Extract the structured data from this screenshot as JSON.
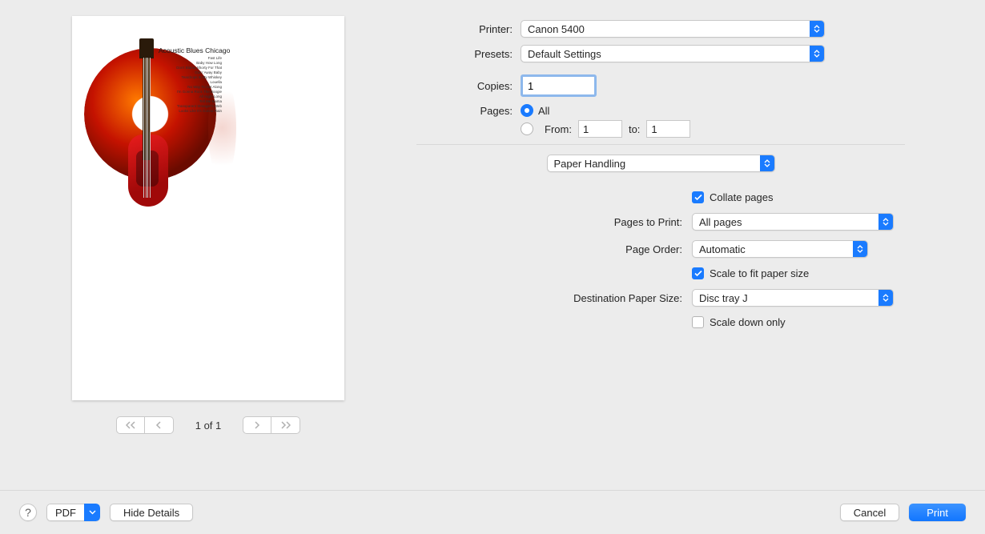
{
  "preview": {
    "album_title": "Acoustic Blues Chicago",
    "tracks": [
      "Fast Life",
      "Baby How Long",
      "Don't Blame Shorty For That",
      "Goin' Away Baby",
      "Teardrops In My Whiskey",
      "Louella",
      "No Way To Get Along",
      "I'm Gonna Rock The Boogie",
      "All Night Long",
      "Tell Me Mama",
      "Transparent Stranger's Web",
      "Looks Like It's Gonna Rain"
    ]
  },
  "pager": {
    "label": "1 of 1"
  },
  "form": {
    "printer_label": "Printer:",
    "printer_value": "Canon 5400",
    "presets_label": "Presets:",
    "presets_value": "Default Settings",
    "copies_label": "Copies:",
    "copies_value": "1",
    "pages_label": "Pages:",
    "pages_all": "All",
    "pages_from_label": "From:",
    "pages_from_value": "1",
    "pages_to_label": "to:",
    "pages_to_value": "1"
  },
  "section": {
    "value": "Paper Handling"
  },
  "options": {
    "collate_label": "Collate pages",
    "collate_checked": true,
    "pages_to_print_label": "Pages to Print:",
    "pages_to_print_value": "All pages",
    "page_order_label": "Page Order:",
    "page_order_value": "Automatic",
    "scale_fit_label": "Scale to fit paper size",
    "scale_fit_checked": true,
    "dest_paper_label": "Destination Paper Size:",
    "dest_paper_value": "Disc tray J",
    "scale_down_label": "Scale down only",
    "scale_down_checked": false
  },
  "footer": {
    "pdf_label": "PDF",
    "hide_details": "Hide Details",
    "cancel": "Cancel",
    "print": "Print"
  }
}
